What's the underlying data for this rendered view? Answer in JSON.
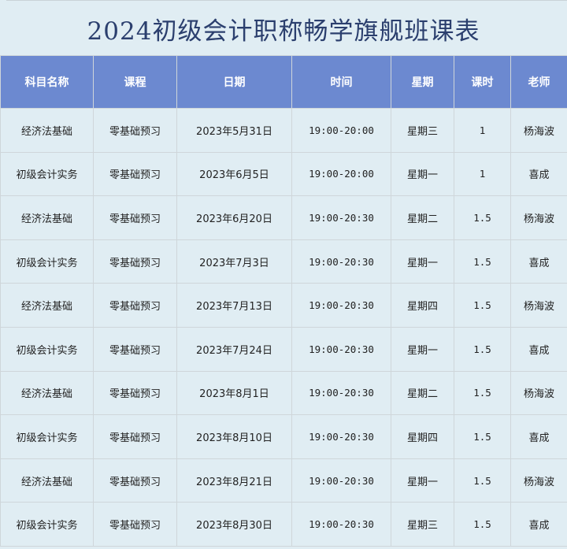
{
  "title": "2024初级会计职称畅学旗舰班课表",
  "headers": [
    "科目名称",
    "课程",
    "日期",
    "时间",
    "星期",
    "课时",
    "老师"
  ],
  "rows": [
    [
      "经济法基础",
      "零基础预习",
      "2023年5月31日",
      "19:00-20:00",
      "星期三",
      "1",
      "杨海波"
    ],
    [
      "初级会计实务",
      "零基础预习",
      "2023年6月5日",
      "19:00-20:00",
      "星期一",
      "1",
      "喜成"
    ],
    [
      "经济法基础",
      "零基础预习",
      "2023年6月20日",
      "19:00-20:30",
      "星期二",
      "1.5",
      "杨海波"
    ],
    [
      "初级会计实务",
      "零基础预习",
      "2023年7月3日",
      "19:00-20:30",
      "星期一",
      "1.5",
      "喜成"
    ],
    [
      "经济法基础",
      "零基础预习",
      "2023年7月13日",
      "19:00-20:30",
      "星期四",
      "1.5",
      "杨海波"
    ],
    [
      "初级会计实务",
      "零基础预习",
      "2023年7月24日",
      "19:00-20:30",
      "星期一",
      "1.5",
      "喜成"
    ],
    [
      "经济法基础",
      "零基础预习",
      "2023年8月1日",
      "19:00-20:30",
      "星期二",
      "1.5",
      "杨海波"
    ],
    [
      "初级会计实务",
      "零基础预习",
      "2023年8月10日",
      "19:00-20:30",
      "星期四",
      "1.5",
      "喜成"
    ],
    [
      "经济法基础",
      "零基础预习",
      "2023年8月21日",
      "19:00-20:30",
      "星期一",
      "1.5",
      "杨海波"
    ],
    [
      "初级会计实务",
      "零基础预习",
      "2023年8月30日",
      "19:00-20:30",
      "星期三",
      "1.5",
      "喜成"
    ]
  ]
}
